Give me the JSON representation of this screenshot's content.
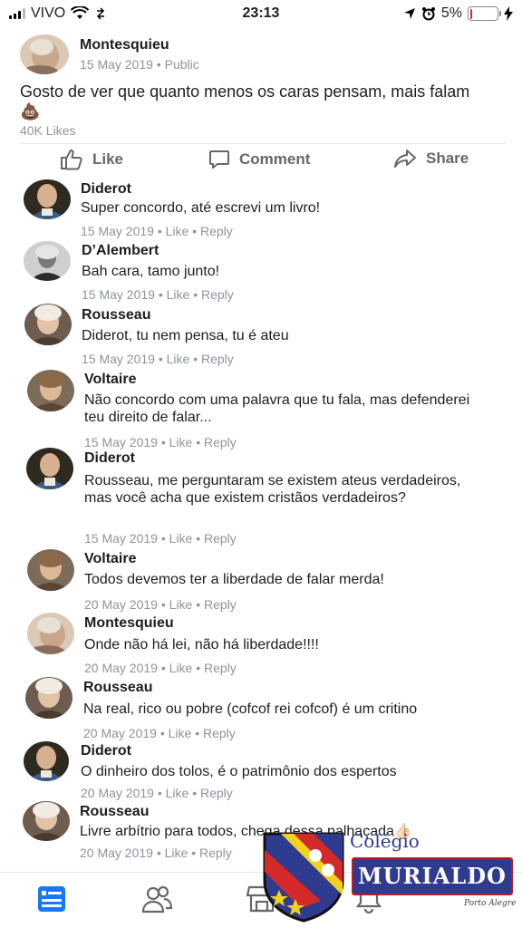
{
  "status_bar": {
    "carrier": "VIVO",
    "time": "23:13",
    "battery_text": "5%",
    "battery_level": 0.05,
    "battery_color": "#e0282e"
  },
  "post": {
    "author": "Montesquieu",
    "date": "15 May 2019 • Public",
    "text": "Gosto de ver que quanto menos os caras pensam, mais falam 💩",
    "likes": "40K Likes"
  },
  "actions": {
    "like": "Like",
    "comment": "Comment",
    "share": "Share"
  },
  "comments": [
    {
      "author": "Diderot",
      "text": "Super concordo, até escrevi um livro!",
      "meta": "15 May 2019 • Like • Reply"
    },
    {
      "author": "D’Alembert",
      "text": "Bah cara, tamo junto!",
      "meta": "15 May 2019 • Like • Reply"
    },
    {
      "author": "Rousseau",
      "text": "Diderot, tu nem pensa, tu é ateu",
      "meta": "15 May 2019 • Like • Reply"
    },
    {
      "author": "Voltaire",
      "text": "Não concordo com uma palavra que tu fala, mas defenderei teu direito de falar...",
      "meta": "15 May 2019 • Like • Reply"
    },
    {
      "author": "Diderot",
      "text": "Rousseau, me perguntaram se existem ateus verdadeiros, mas você acha que existem cristãos verdadeiros?",
      "meta": "15 May 2019 • Like • Reply"
    },
    {
      "author": "Voltaire",
      "text": "Todos devemos ter a liberdade de falar merda!",
      "meta": "20 May 2019 • Like • Reply"
    },
    {
      "author": "Montesquieu",
      "text": "Onde não há lei, não há liberdade!!!!",
      "meta": "20 May 2019 • Like • Reply"
    },
    {
      "author": "Rousseau",
      "text": "Na real, rico ou pobre (cofcof rei cofcof) é um critino",
      "meta": "20 May 2019 • Like • Reply"
    },
    {
      "author": "Diderot",
      "text": "O dinheiro dos tolos, é o patrimônio dos espertos",
      "meta": "20 May 2019 • Like • Reply"
    },
    {
      "author": "Rousseau",
      "text": "Livre arbítrio para todos, chega dessa palhaçada👍🏻",
      "meta": "20 May 2019 • Like • Reply"
    }
  ],
  "watermark": {
    "line1": "Colégio",
    "line2": "MURIALDO",
    "line3": "Porto Alegre"
  },
  "bottom_nav": [
    "feed-icon",
    "friends-icon",
    "marketplace-icon",
    "notifications-icon"
  ],
  "colors": {
    "accent": "#1877f2",
    "meta_gray": "#8d949e"
  }
}
